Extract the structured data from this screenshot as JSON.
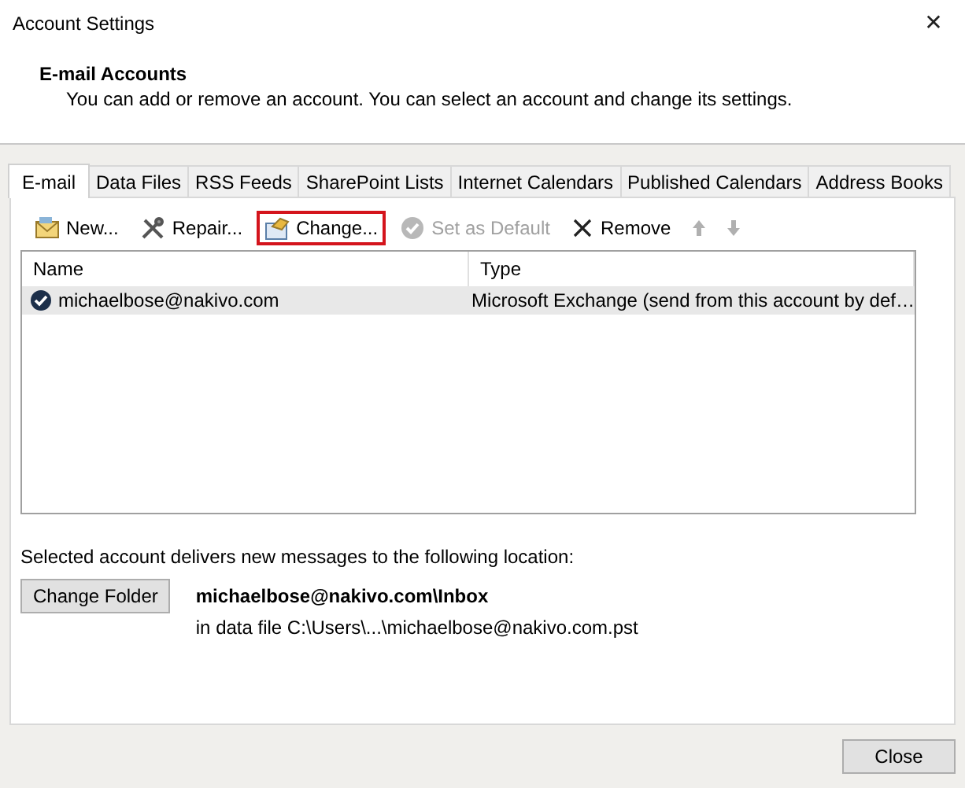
{
  "window": {
    "title": "Account Settings",
    "close": "✕"
  },
  "header": {
    "title": "E-mail Accounts",
    "description": "You can add or remove an account. You can select an account and change its settings."
  },
  "tabs": [
    {
      "label": "E-mail",
      "selected": true
    },
    {
      "label": "Data Files",
      "selected": false
    },
    {
      "label": "RSS Feeds",
      "selected": false
    },
    {
      "label": "SharePoint Lists",
      "selected": false
    },
    {
      "label": "Internet Calendars",
      "selected": false
    },
    {
      "label": "Published Calendars",
      "selected": false
    },
    {
      "label": "Address Books",
      "selected": false
    }
  ],
  "toolbar": [
    {
      "kind": "new",
      "label": "New...",
      "disabled": false,
      "highlighted": false
    },
    {
      "kind": "repair",
      "label": "Repair...",
      "disabled": false,
      "highlighted": false
    },
    {
      "kind": "change",
      "label": "Change...",
      "disabled": false,
      "highlighted": true
    },
    {
      "kind": "default",
      "label": "Set as Default",
      "disabled": true,
      "highlighted": false
    },
    {
      "kind": "remove",
      "label": "Remove",
      "disabled": false,
      "highlighted": false
    },
    {
      "kind": "up",
      "disabled": true,
      "highlighted": false
    },
    {
      "kind": "down",
      "disabled": true,
      "highlighted": false
    }
  ],
  "table": {
    "columns": [
      "Name",
      "Type"
    ],
    "rows": [
      {
        "name": "michaelbose@nakivo.com",
        "type": "Microsoft Exchange (send from this account by def…",
        "selected": true
      }
    ]
  },
  "location": {
    "caption": "Selected account delivers new messages to the following location:",
    "button": "Change Folder",
    "folder": "michaelbose@nakivo.com\\Inbox",
    "data_file": "in data file C:\\Users\\...\\michaelbose@nakivo.com.pst"
  },
  "buttons": [
    "Close"
  ]
}
